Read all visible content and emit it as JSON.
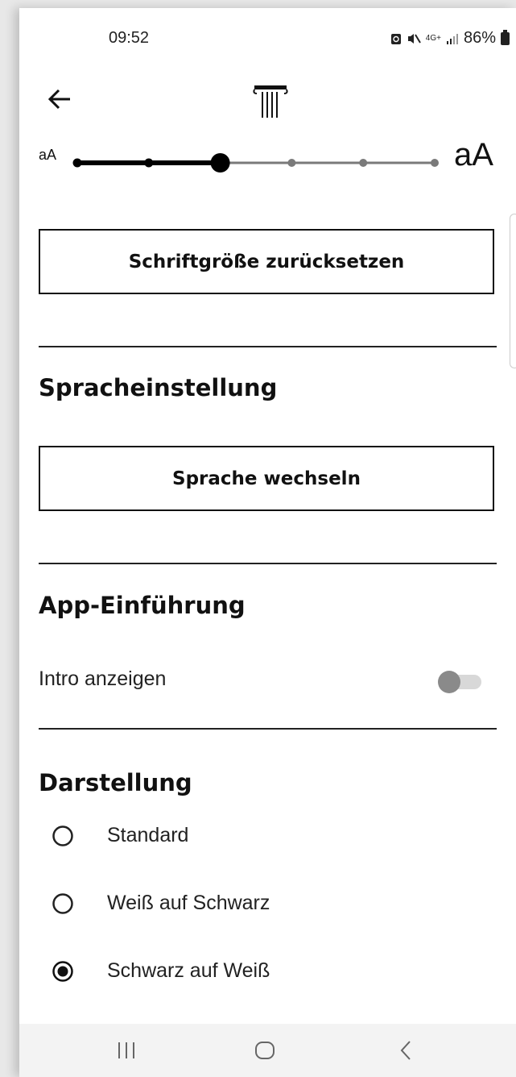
{
  "status_bar": {
    "time": "09:52",
    "network": "4G+",
    "battery": "86%"
  },
  "font_size": {
    "small_label": "aA",
    "large_label": "aA",
    "steps": 6,
    "selected_step": 3,
    "reset_label": "Schriftgröße zurücksetzen"
  },
  "language": {
    "title": "Spracheinstellung",
    "button_label": "Sprache wechseln"
  },
  "intro": {
    "title": "App-Einführung",
    "toggle_label": "Intro anzeigen",
    "toggle_on": false
  },
  "display": {
    "title": "Darstellung",
    "options": [
      {
        "label": "Standard",
        "selected": false
      },
      {
        "label": "Weiß auf Schwarz",
        "selected": false
      },
      {
        "label": "Schwarz auf Weiß",
        "selected": true
      }
    ]
  },
  "colors": {
    "text": "#111111",
    "toggle_thumb_off": "#8a8a8a",
    "toggle_track_off": "#d8d8d8",
    "slider_active": "#000000",
    "slider_inactive": "#7a7a7a"
  },
  "icons": {
    "back": "arrow-left-icon",
    "logo": "column-logo-icon",
    "nav_recents": "recents-icon",
    "nav_home": "home-icon",
    "nav_back": "nav-back-icon"
  }
}
